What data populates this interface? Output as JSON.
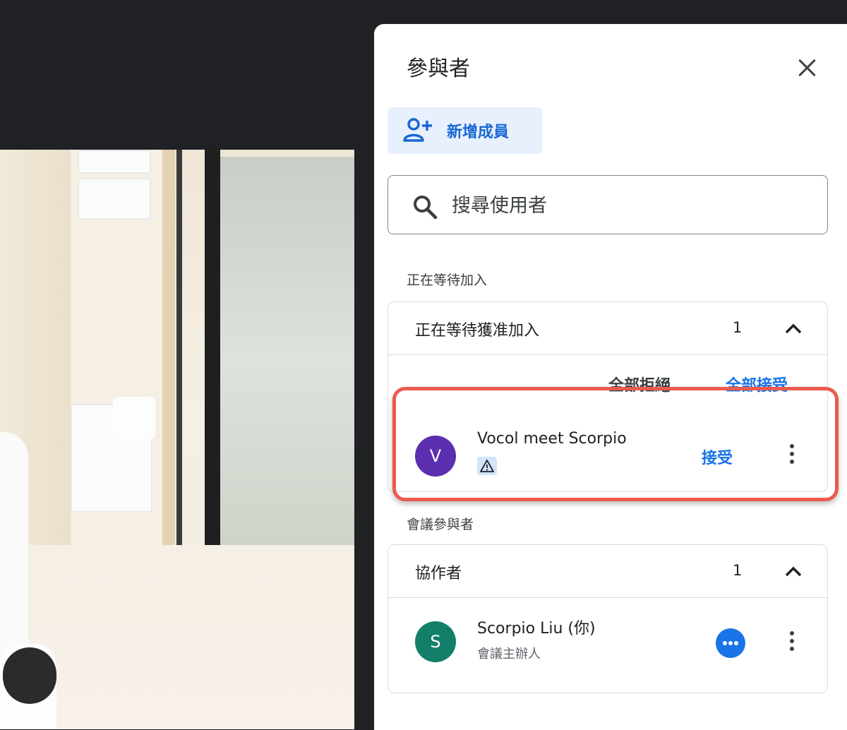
{
  "panel": {
    "title": "參與者",
    "add_member_label": "新增成員",
    "search_placeholder": "搜尋使用者"
  },
  "waiting": {
    "section_label": "正在等待加入",
    "group_name": "正在等待獲准加入",
    "count": "1",
    "deny_all_label": "全部拒絕",
    "accept_all_label": "全部接受",
    "requests": [
      {
        "initial": "V",
        "name": "Vocol meet Scorpio",
        "accept_label": "接受"
      }
    ]
  },
  "participants": {
    "section_label": "會議參與者",
    "group_name": "協作者",
    "count": "1",
    "members": [
      {
        "initial": "S",
        "name": "Scorpio Liu (你)",
        "role": "會議主辦人"
      }
    ]
  },
  "colors": {
    "accent": "#1a73e8",
    "avatar_v": "#5b2fb0",
    "avatar_s": "#137f6a",
    "highlight": "#ea5a4f"
  }
}
